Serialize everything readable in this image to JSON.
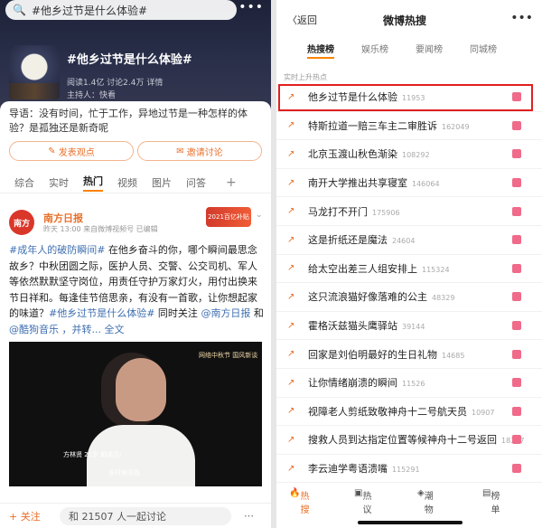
{
  "left": {
    "search": {
      "text": "#他乡过节是什么体验#"
    },
    "more": "•••",
    "topic": {
      "title": "#他乡过节是什么体验#",
      "meta": "阅读1.4亿  讨论2.4万  详情",
      "host": "主持人：快看",
      "intro": "导语：没有时间，忙于工作，异地过节是一种怎样的体验？是孤独还是新奇呢",
      "btn_post": "发表观点",
      "btn_invite": "邀请讨论"
    },
    "tabs": [
      "综合",
      "实时",
      "热门",
      "视频",
      "图片",
      "问答"
    ],
    "tabs_plus": "+",
    "post": {
      "avatar_text": "南方",
      "name": "南方日报",
      "time": "昨天 13:00 来自微博视频号 已编辑",
      "stamp": "2021百亿补贴",
      "text_1": "#成年人的破防瞬间#",
      "text_2": " 在他乡奋斗的你，哪个瞬间最思念故乡？中秋团圆之际，医护人员、交警、公交司机、军人等依然默默坚守岗位，用责任守护万家灯火，用付出换来节日祥和。每逢佳节倍思亲，有没有一首歌，让你想起家的味道？",
      "text_3": "#他乡过节是什么体验#",
      "text_4": " 同时关注 ",
      "text_5": "@南方日报",
      "text_6": " 和 ",
      "text_7": "@酷狗音乐",
      "text_8": " ，并转... 全文"
    },
    "video": {
      "badge": "网络中秋节 国风新谈",
      "caption": "方林贤 21岁 邮递员/",
      "sub": "多时候没有"
    },
    "bottom": {
      "follow": "+ 关注",
      "discuss": "和 21507 人一起讨论",
      "share": "⋯"
    }
  },
  "right": {
    "back": "〈返回",
    "title": "微博热搜",
    "dots": "•••",
    "tabs": [
      "热搜榜",
      "娱乐榜",
      "要闻榜",
      "同城榜"
    ],
    "section": "实时上升热点",
    "items": [
      {
        "text": "他乡过节是什么体验",
        "num": "11953"
      },
      {
        "text": "特斯拉道一赔三车主二审胜诉",
        "num": "162049"
      },
      {
        "text": "北京玉渡山秋色渐染",
        "num": "108292"
      },
      {
        "text": "南开大学推出共享寝室",
        "num": "146064"
      },
      {
        "text": "马龙打不开门",
        "num": "175906"
      },
      {
        "text": "这是折纸还是魔法",
        "num": "24604"
      },
      {
        "text": "给太空出差三人组安排上",
        "num": "115324"
      },
      {
        "text": "这只流浪猫好像落难的公主",
        "num": "48329"
      },
      {
        "text": "霍格沃兹猫头鹰驿站",
        "num": "39144"
      },
      {
        "text": "回家是刘伯明最好的生日礼物",
        "num": "14685"
      },
      {
        "text": "让你情绪崩溃的瞬间",
        "num": "11526"
      },
      {
        "text": "视障老人剪纸致敬神舟十二号航天员",
        "num": "10907"
      },
      {
        "text": "搜救人员到达指定位置等候神舟十二号返回",
        "num": "18377"
      },
      {
        "text": "李云迪学粤语溃嘴",
        "num": "115291"
      }
    ],
    "bottom": [
      "热搜",
      "热议",
      "潮物",
      "榜单"
    ]
  },
  "colors": {
    "accent": "#ff8200",
    "link": "#3f6fb0",
    "highlight_box": "#e02020"
  }
}
